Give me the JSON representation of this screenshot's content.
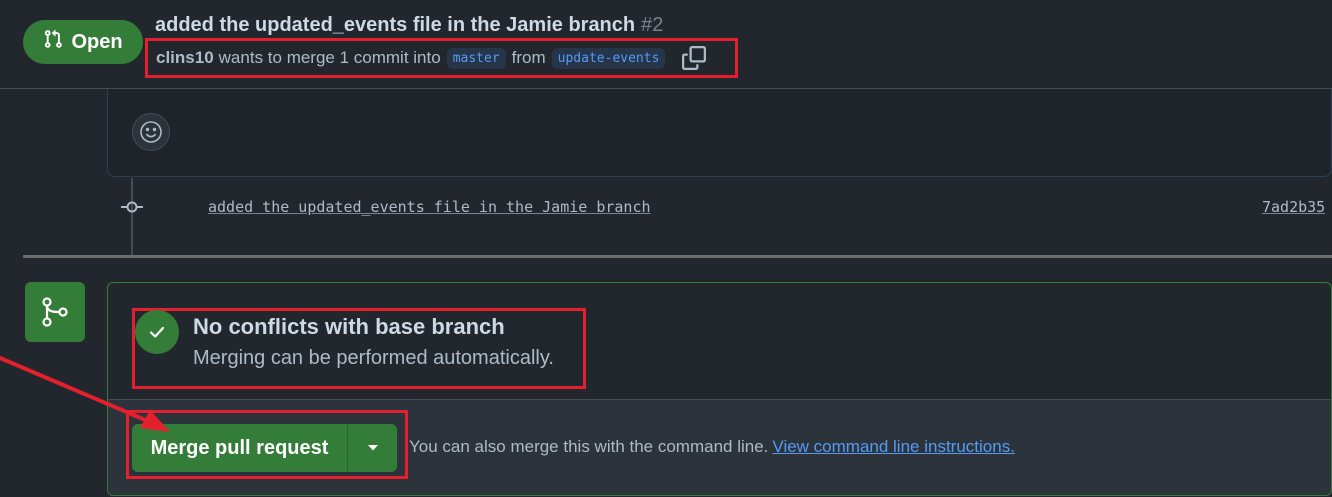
{
  "header": {
    "status_badge": "Open",
    "title": "added the updated_events file in the Jamie branch",
    "number": "#2",
    "author": "clins10",
    "merge_text": "wants to merge 1 commit into",
    "base_branch": "master",
    "from_text": "from",
    "head_branch": "update-events"
  },
  "timeline": {
    "commit_message": "added the updated_events file in the Jamie branch",
    "commit_sha": "7ad2b35"
  },
  "merge_box": {
    "status_title": "No conflicts with base branch",
    "status_subtitle": "Merging can be performed automatically.",
    "merge_button": "Merge pull request",
    "cli_text": "You can also merge this with the command line.",
    "cli_link": "View command line instructions."
  },
  "colors": {
    "accent_green": "#347d39",
    "annotation_red": "#e5202e",
    "link_blue": "#539bf5"
  }
}
